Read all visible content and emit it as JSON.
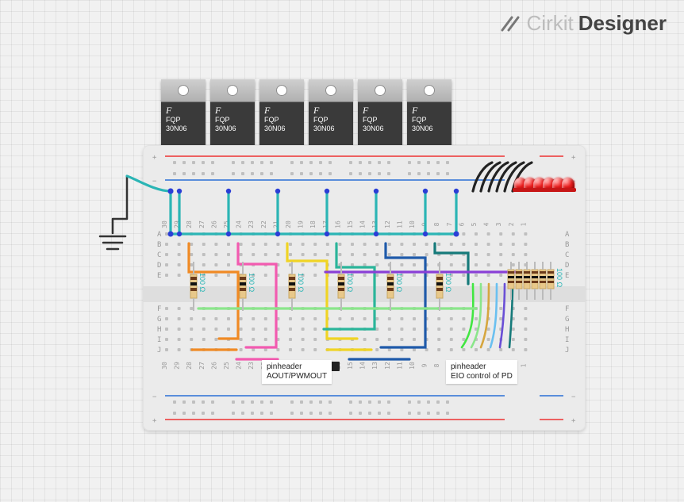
{
  "brand": {
    "name1": "Cirkit",
    "name2": "Designer"
  },
  "mosfet": {
    "line1": "FQP",
    "line2": "30N06"
  },
  "labels": {
    "pinheader1_a": "pinheader",
    "pinheader1_b": "AOUT/PWMOUT",
    "pinheader2_a": "pinheader",
    "pinheader2_b": "EIO control of PD"
  },
  "resistor_value": "100 Ω",
  "breadboard": {
    "rows_top": [
      "A",
      "B",
      "C",
      "D",
      "E"
    ],
    "rows_bot": [
      "F",
      "G",
      "H",
      "I",
      "J"
    ],
    "cols_max": 30
  },
  "chart_data": {
    "type": "diagram",
    "description": "Breadboard circuit with six N-channel MOSFETs (FQP30N06) driving six red LEDs. Gate lines go to a pin header labeled AOUT/PWMOUT; control/status lines go to a pin header labeled EIO control of PD. 100 Ω resistors in series. A common rail is tied to ground.",
    "components": [
      {
        "type": "MOSFET",
        "part": "FQP30N06",
        "qty": 6
      },
      {
        "type": "LED",
        "color": "red",
        "qty": 6
      },
      {
        "type": "Resistor",
        "value_ohms": 100,
        "qty": 12
      },
      {
        "type": "PinHeader",
        "name": "AOUT/PWMOUT"
      },
      {
        "type": "PinHeader",
        "name": "EIO control of PD"
      },
      {
        "type": "Ground"
      }
    ],
    "wire_colors_hex": {
      "teal": "#2bb5b5",
      "blue": "#2b3ed6",
      "orange": "#f08a24",
      "pink": "#f25bb0",
      "yellow": "#f0d424",
      "greenblue": "#2bb59a",
      "navy": "#1f5aaa",
      "darkteal": "#167a7a",
      "purple": "#8a3fd6",
      "brightgreen": "#42e642",
      "lightgreen": "#8ae68a",
      "gold": "#d6a63f",
      "lightblue": "#6ac0f0",
      "violet": "#6a4fd6",
      "black": "#222"
    }
  }
}
